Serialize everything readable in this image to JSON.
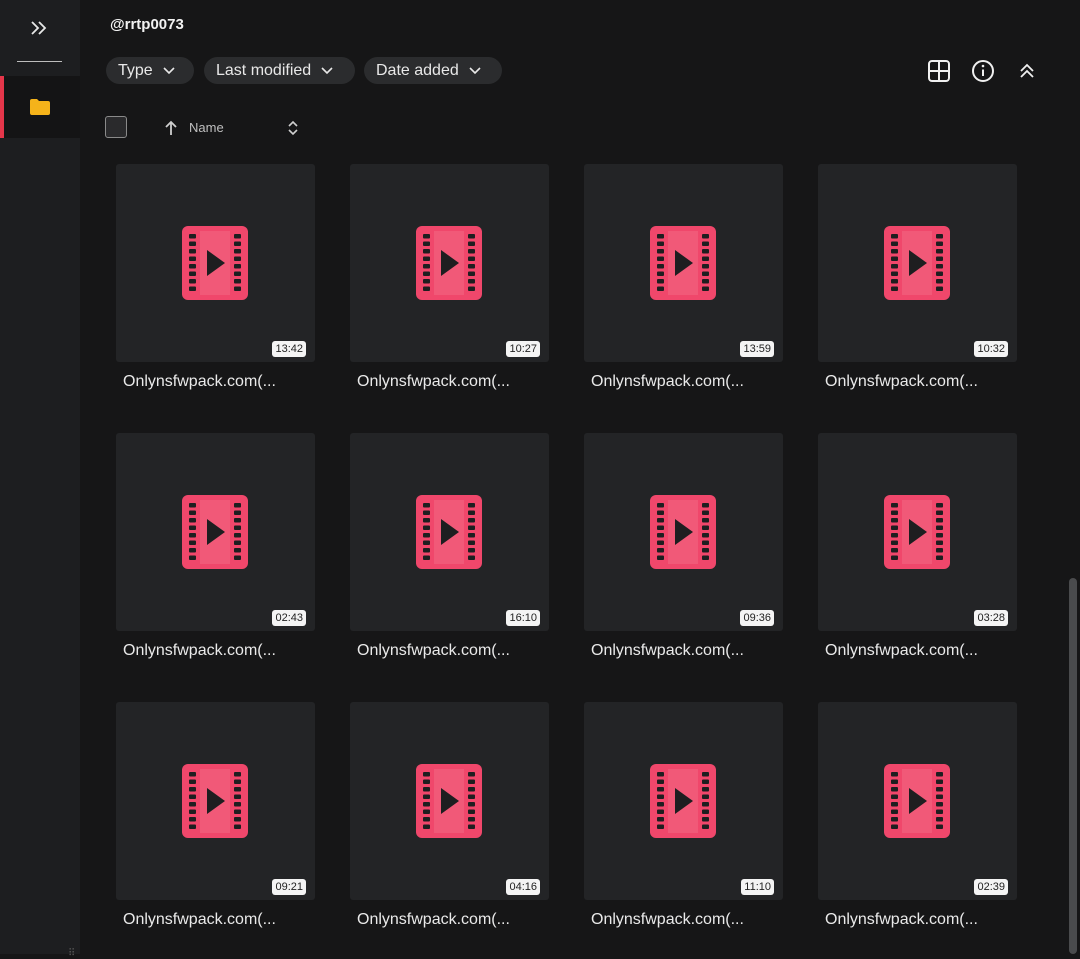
{
  "header": {
    "title": "@rrtp0073"
  },
  "filters": {
    "type": "Type",
    "last_modified": "Last modified",
    "date_added": "Date added"
  },
  "sort": {
    "label": "Name"
  },
  "accent_color": "#e5364a",
  "icons": {
    "folder": "#f5b31a",
    "video": "#f0476b"
  },
  "files": [
    {
      "name": "Onlynsfwpack.com(...",
      "duration": "13:42"
    },
    {
      "name": "Onlynsfwpack.com(...",
      "duration": "10:27"
    },
    {
      "name": "Onlynsfwpack.com(...",
      "duration": "13:59"
    },
    {
      "name": "Onlynsfwpack.com(...",
      "duration": "10:32"
    },
    {
      "name": "Onlynsfwpack.com(...",
      "duration": "02:43"
    },
    {
      "name": "Onlynsfwpack.com(...",
      "duration": "16:10"
    },
    {
      "name": "Onlynsfwpack.com(...",
      "duration": "09:36"
    },
    {
      "name": "Onlynsfwpack.com(...",
      "duration": "03:28"
    },
    {
      "name": "Onlynsfwpack.com(...",
      "duration": "09:21"
    },
    {
      "name": "Onlynsfwpack.com(...",
      "duration": "04:16"
    },
    {
      "name": "Onlynsfwpack.com(...",
      "duration": "11:10"
    },
    {
      "name": "Onlynsfwpack.com(...",
      "duration": "02:39"
    }
  ]
}
